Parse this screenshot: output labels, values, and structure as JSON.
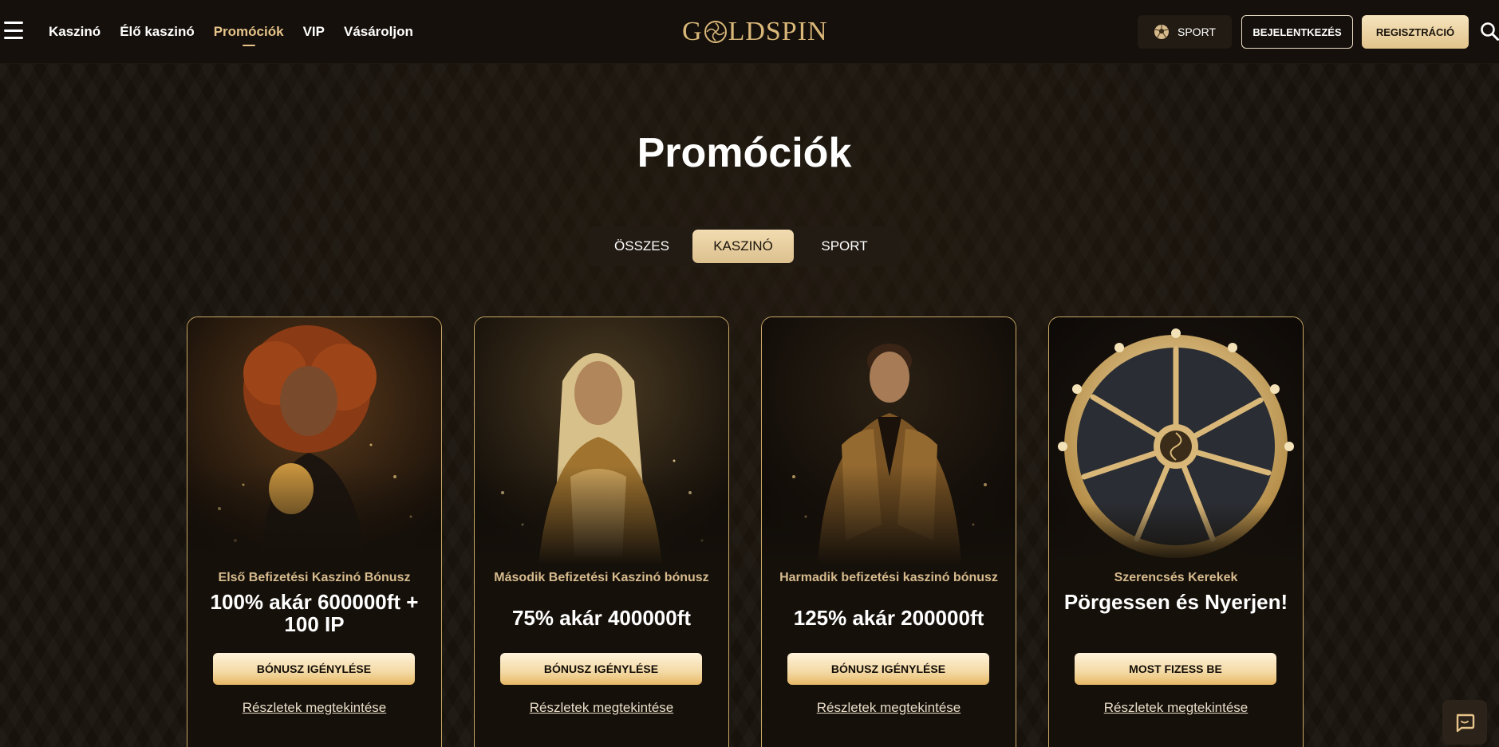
{
  "header": {
    "nav": [
      "Kaszinó",
      "Élő kaszinó",
      "Promóciók",
      "VIP",
      "Vásároljon"
    ],
    "logo_left": "GOLD",
    "logo_right": "SPIN",
    "sport_label": "SPORT",
    "login_label": "BEJELENTKEZÉS",
    "register_label": "REGISZTRÁCIÓ"
  },
  "page": {
    "title": "Promóciók"
  },
  "tabs": [
    "ÖSSZES",
    "KASZINÓ",
    "SPORT"
  ],
  "active_tab": "KASZINÓ",
  "cards": [
    {
      "subtitle": "Első Befizetési Kaszinó Bónusz",
      "headline": "100% akár 600000ft + 100 IP",
      "cta": "BÓNUSZ IGÉNYLÉSE",
      "details": "Részletek megtekintése"
    },
    {
      "subtitle": "Második Befizetési Kaszinó bónusz",
      "headline": "75% akár 400000ft",
      "cta": "BÓNUSZ IGÉNYLÉSE",
      "details": "Részletek megtekintése"
    },
    {
      "subtitle": "Harmadik befizetési kaszinó bónusz",
      "headline": "125% akár 200000ft",
      "cta": "BÓNUSZ IGÉNYLÉSE",
      "details": "Részletek megtekintése"
    },
    {
      "subtitle": "Szerencsés Kerekek",
      "headline": "Pörgessen és Nyerjen!",
      "cta": "MOST FIZESS BE",
      "details": "Részletek megtekintése"
    }
  ],
  "colors": {
    "accent": "#e6c48a",
    "background": "#17120c",
    "card_border": "#c9a866"
  },
  "icons": [
    "menu-icon",
    "soccer-ball-icon",
    "search-icon",
    "chat-icon"
  ]
}
